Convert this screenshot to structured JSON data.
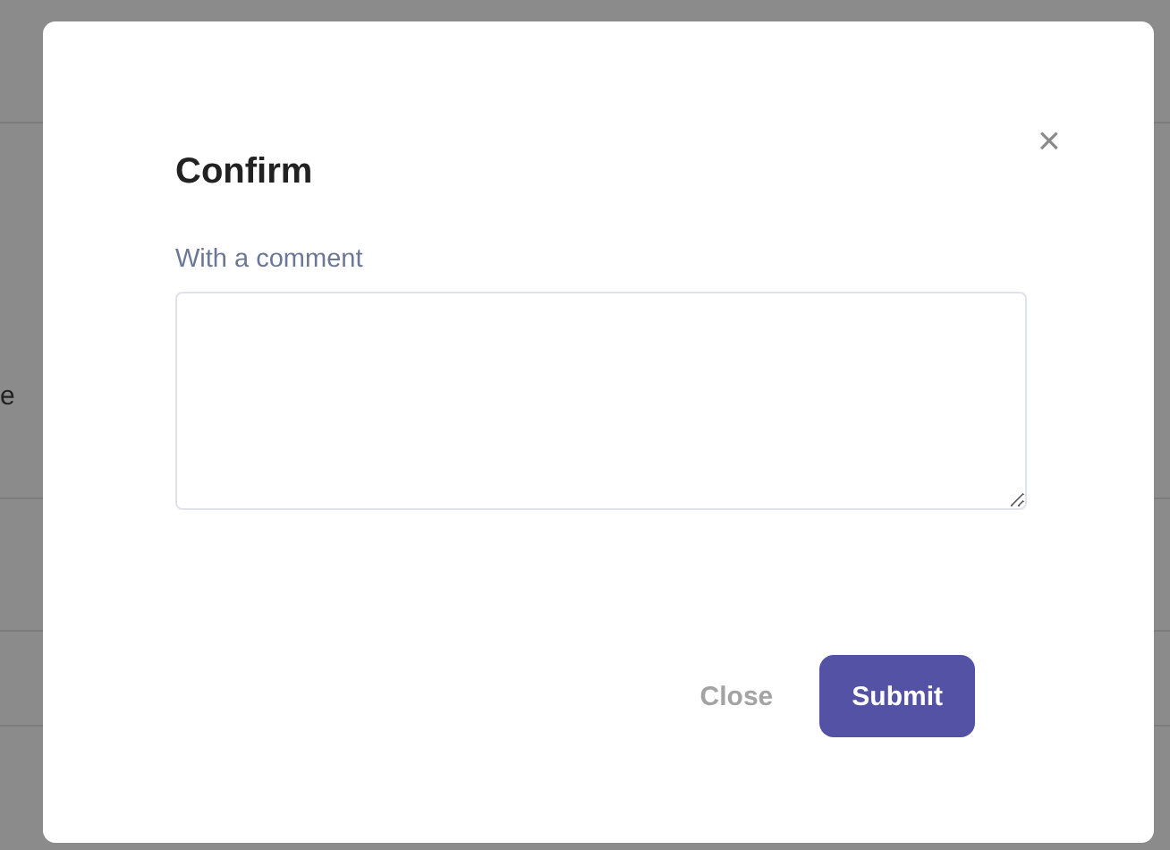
{
  "background": {
    "fragment": "e"
  },
  "dialog": {
    "title": "Confirm",
    "close_icon": "×",
    "field_label": "With a comment",
    "buttons": [
      {
        "label": "Close",
        "kind": "secondary"
      },
      {
        "label": "Submit",
        "kind": "primary"
      }
    ]
  }
}
